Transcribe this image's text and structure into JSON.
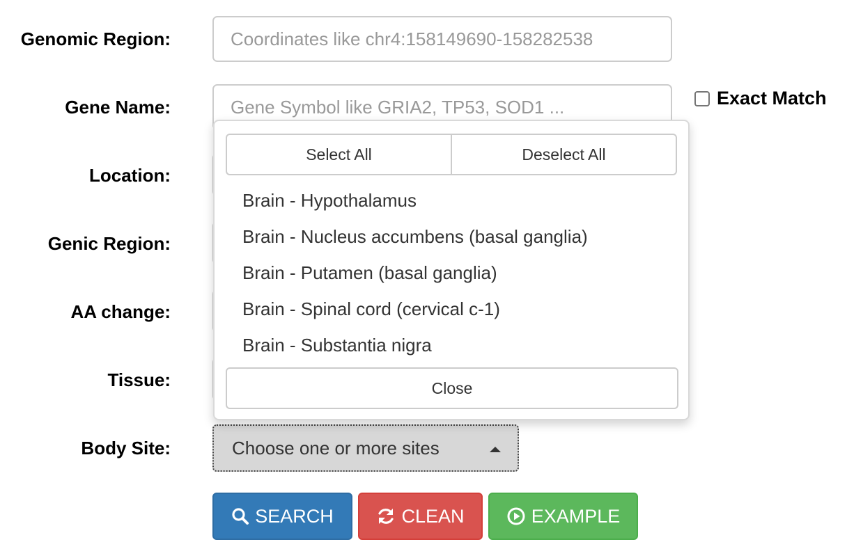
{
  "form": {
    "genomic_region": {
      "label": "Genomic Region:",
      "placeholder": "Coordinates like chr4:158149690-158282538",
      "value": ""
    },
    "gene_name": {
      "label": "Gene Name:",
      "placeholder": "Gene Symbol like GRIA2, TP53, SOD1 ...",
      "value": ""
    },
    "exact_match": {
      "label": "Exact Match",
      "checked": false
    },
    "location": {
      "label": "Location:"
    },
    "genic_region": {
      "label": "Genic Region:"
    },
    "aa_change": {
      "label": "AA change:"
    },
    "tissue": {
      "label": "Tissue:"
    },
    "body_site": {
      "label": "Body Site:",
      "selected_text": "Choose one or more sites"
    }
  },
  "dropdown": {
    "select_all": "Select All",
    "deselect_all": "Deselect All",
    "options": [
      "Brain - Hypothalamus",
      "Brain - Nucleus accumbens (basal ganglia)",
      "Brain - Putamen (basal ganglia)",
      "Brain - Spinal cord (cervical c-1)",
      "Brain - Substantia nigra"
    ],
    "close": "Close"
  },
  "actions": {
    "search": {
      "label": "SEARCH",
      "icon": "search-icon",
      "color": "#337ab7"
    },
    "clean": {
      "label": "CLEAN",
      "icon": "refresh-icon",
      "color": "#d9534f"
    },
    "example": {
      "label": "EXAMPLE",
      "icon": "play-circle-icon",
      "color": "#5cb85c"
    }
  }
}
